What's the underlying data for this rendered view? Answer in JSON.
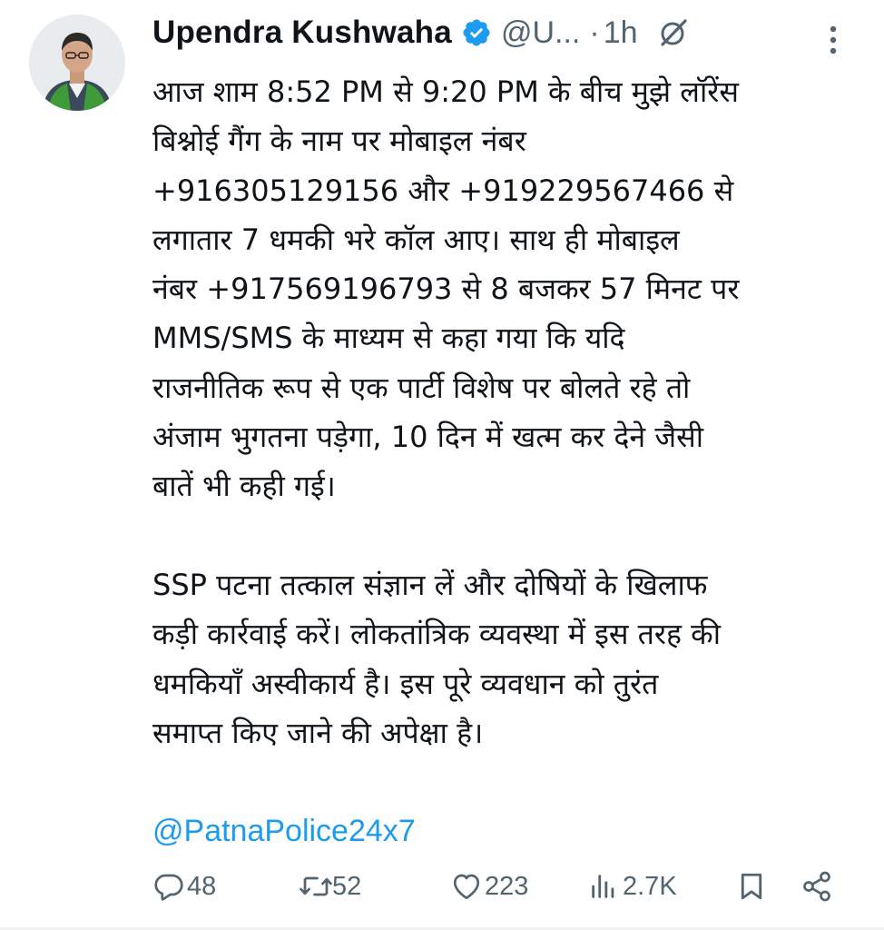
{
  "author": {
    "display_name": "Upendra Kushwaha",
    "handle": "@U...",
    "separator": "·",
    "time": "1h"
  },
  "post": {
    "text": "आज शाम 8:52 PM से 9:20 PM के बीच मुझे लॉरेंस\nबिश्नोई गैंग के नाम पर मोबाइल नंबर\n+916305129156 और +919229567466 से\nलगातार 7 धमकी भरे कॉल आए। साथ ही मोबाइल\nनंबर +917569196793 से 8 बजकर 57 मिनट पर\nMMS/SMS के माध्यम से कहा गया कि यदि\nराजनीतिक रूप से एक पार्टी विशेष पर बोलते रहे तो\nअंजाम भुगतना पड़ेगा, 10 दिन में खत्म कर देने जैसी\nबातें भी कही गई।\n\nSSP पटना तत्काल संज्ञान लें और दोषियों के खिलाफ\nकड़ी कार्रवाई करें। लोकतांत्रिक व्यवस्था में इस तरह की\nधमकियाँ अस्वीकार्य है। इस पूरे व्यवधान को तुरंत\nसमाप्त किए जाने की अपेक्षा है।",
    "mention": "@PatnaPolice24x7"
  },
  "actions": {
    "replies": "48",
    "reposts": "52",
    "likes": "223",
    "views": "2.7K"
  },
  "icons": {
    "verified": "verified-badge-icon",
    "grok": "grok-icon",
    "more": "more-vertical-icon",
    "reply": "reply-icon",
    "repost": "repost-icon",
    "like": "heart-icon",
    "views": "views-icon",
    "bookmark": "bookmark-icon",
    "share": "share-icon"
  },
  "colors": {
    "text": "#0f1419",
    "secondary": "#536471",
    "link": "#1d9bf0",
    "verified": "#1d9bf0"
  }
}
